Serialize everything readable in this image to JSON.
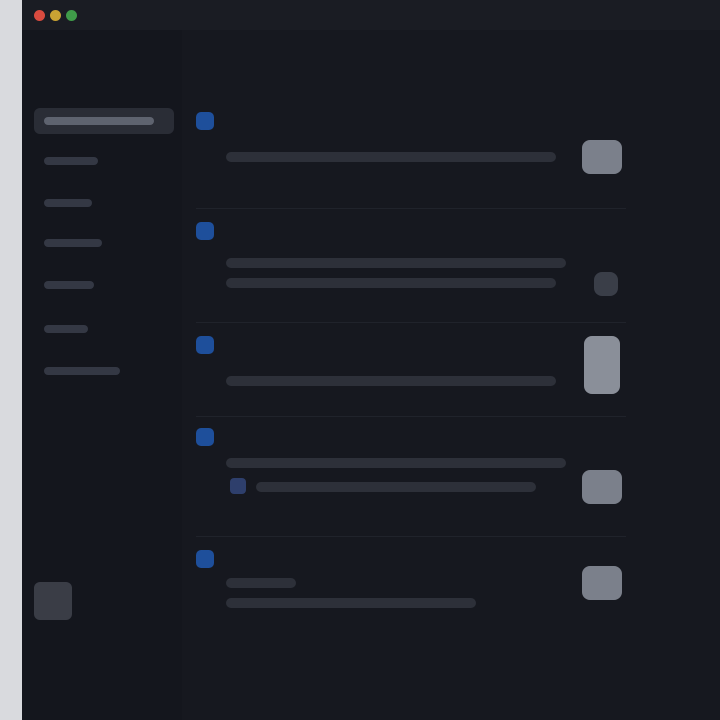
{
  "window": {
    "title": "",
    "colors": {
      "background": "#16181f",
      "sidebar": "#14161d",
      "accent": "#1e4f9b",
      "control": "#7b808b"
    }
  },
  "sidebar": {
    "section_label": "",
    "items": [
      {
        "label": "",
        "active": true
      },
      {
        "label": "",
        "active": false
      },
      {
        "label": "",
        "active": false
      },
      {
        "label": "",
        "active": false
      },
      {
        "label": "",
        "active": false
      },
      {
        "label": "",
        "active": false
      },
      {
        "label": "",
        "active": false
      }
    ],
    "bottom_button_icon": "user-avatar-icon"
  },
  "settings": [
    {
      "icon": "setting-icon",
      "title": "",
      "description": "",
      "control": "toggle-icon"
    },
    {
      "icon": "setting-icon",
      "title": "",
      "description": "",
      "control": "chevron-icon"
    },
    {
      "icon": "setting-icon",
      "title": "",
      "description": "",
      "control": "slider-icon"
    },
    {
      "icon": "setting-icon",
      "title": "",
      "description": "",
      "control": "toggle-icon"
    },
    {
      "icon": "setting-icon",
      "title": "",
      "description": "",
      "control": "toggle-icon"
    }
  ]
}
